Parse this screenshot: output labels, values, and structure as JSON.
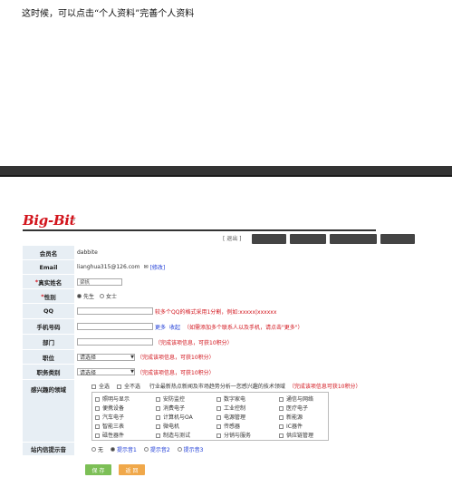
{
  "note": "这时候，可以点击“个人资料”完善个人资料",
  "logo": {
    "text": "Big-Bit"
  },
  "topbar": {
    "text": "[ 退出 ]"
  },
  "form": {
    "username": {
      "label": "会员名",
      "value": "dabbite"
    },
    "email": {
      "label": "Email",
      "value": "lianghua315@126.com",
      "edit": "[修改]"
    },
    "realname": {
      "label": "真实姓名",
      "value": "梁帆"
    },
    "gender": {
      "label": "性别",
      "options": [
        "先生",
        "女士"
      ],
      "selected": "先生"
    },
    "qq": {
      "label": "QQ",
      "hint": "较多个QQ的格式采用1分割，例如:xxxxx|xxxxxx"
    },
    "mobile": {
      "label": "手机号码",
      "more": "更多",
      "collapse": "收起",
      "hint": "（如需添加多个联系人以及手机，请点击\"更多\"）"
    },
    "dept": {
      "label": "部门",
      "hint": "（完成该项信息，可获10积分）"
    },
    "position": {
      "label": "职位",
      "placeholder": "请选择",
      "hint": "（完成该项信息，可获10积分）"
    },
    "position_type": {
      "label": "职务类别",
      "placeholder": "请选择",
      "hint": "（完成该项信息，可获10积分）"
    },
    "interest": {
      "label": "感兴趣的领域",
      "select_all": "全选",
      "select_none": "全不选",
      "desc": "行业最新热点新闻及市场趋势分析一您感兴趣的技术领域",
      "hint": "（完成该项信息可获10积分）",
      "items": [
        "照明与显示",
        "安防监控",
        "数字家电",
        "通信与网络",
        "便携设备",
        "消费电子",
        "工业控制",
        "医疗电子",
        "汽车电子",
        "计算机与OA",
        "电源管理",
        "新能源",
        "智能三表",
        "微电机",
        "传感器",
        "IC器件",
        "磁性器件",
        "制造与测试",
        "分销与服务",
        "供应链管理"
      ]
    },
    "sitemsg": {
      "label": "站内信提示音",
      "options": [
        "无",
        "提示音1",
        "提示音2",
        "提示音3"
      ],
      "selected": "提示音1"
    },
    "save": "保 存",
    "back": "返 回"
  }
}
